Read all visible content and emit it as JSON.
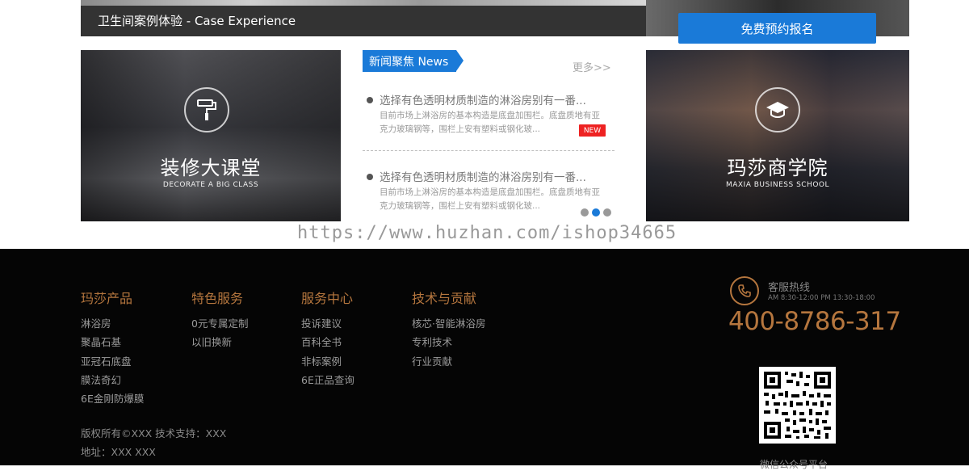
{
  "case_bar": {
    "title": "卫生间案例体验 - Case Experience"
  },
  "signup": {
    "label": "免费预约报名"
  },
  "panels": {
    "left": {
      "title": "装修大课堂",
      "subtitle": "DECORATE A BIG CLASS",
      "icon": "paint-roller-icon"
    },
    "right": {
      "title": "玛莎商学院",
      "subtitle": "MAXIA BUSINESS SCHOOL",
      "icon": "graduation-cap-icon"
    }
  },
  "news": {
    "tag": "新闻聚焦 News",
    "more": "更多>>",
    "items": [
      {
        "title": "选择有色透明材质制造的淋浴房别有一番...",
        "desc": "目前市场上淋浴房的基本构造是底盘加围栏。底盘质地有亚克力玻璃钢等，围栏上安有塑料或钢化玻...",
        "badge": "NEW"
      },
      {
        "title": "选择有色透明材质制造的淋浴房别有一番...",
        "desc": "目前市场上淋浴房的基本构造是底盘加围栏。底盘质地有亚克力玻璃钢等，围栏上安有塑料或钢化玻..."
      }
    ],
    "pager_active": 2
  },
  "watermark": "https://www.huzhan.com/ishop34665",
  "footer": {
    "columns": [
      {
        "heading": "玛莎产品",
        "links": [
          "淋浴房",
          "聚晶石基",
          "亚冠石底盘",
          "膜法奇幻",
          "6E金刚防爆膜"
        ]
      },
      {
        "heading": "特色服务",
        "links": [
          "0元专属定制",
          "以旧换新"
        ]
      },
      {
        "heading": "服务中心",
        "links": [
          "投诉建议",
          "百科全书",
          "非标案例",
          "6E正品查询"
        ]
      },
      {
        "heading": "技术与贡献",
        "links": [
          "核芯·智能淋浴房",
          "专利技术",
          "行业贡献"
        ]
      }
    ],
    "copyright": "版权所有©XXX 技术支持：XXX",
    "address": "地址：XXX XXX",
    "hotline": {
      "label": "客服热线",
      "hours": "AM 8:30-12:00 PM 13:30-18:00",
      "number": "400-8786-317",
      "icon": "phone-icon"
    },
    "qr_caption": "微信公众号平台"
  },
  "colors": {
    "accent_blue": "#1a7ad8",
    "footer_gold": "#b5763e",
    "badge_red": "#e22222"
  }
}
